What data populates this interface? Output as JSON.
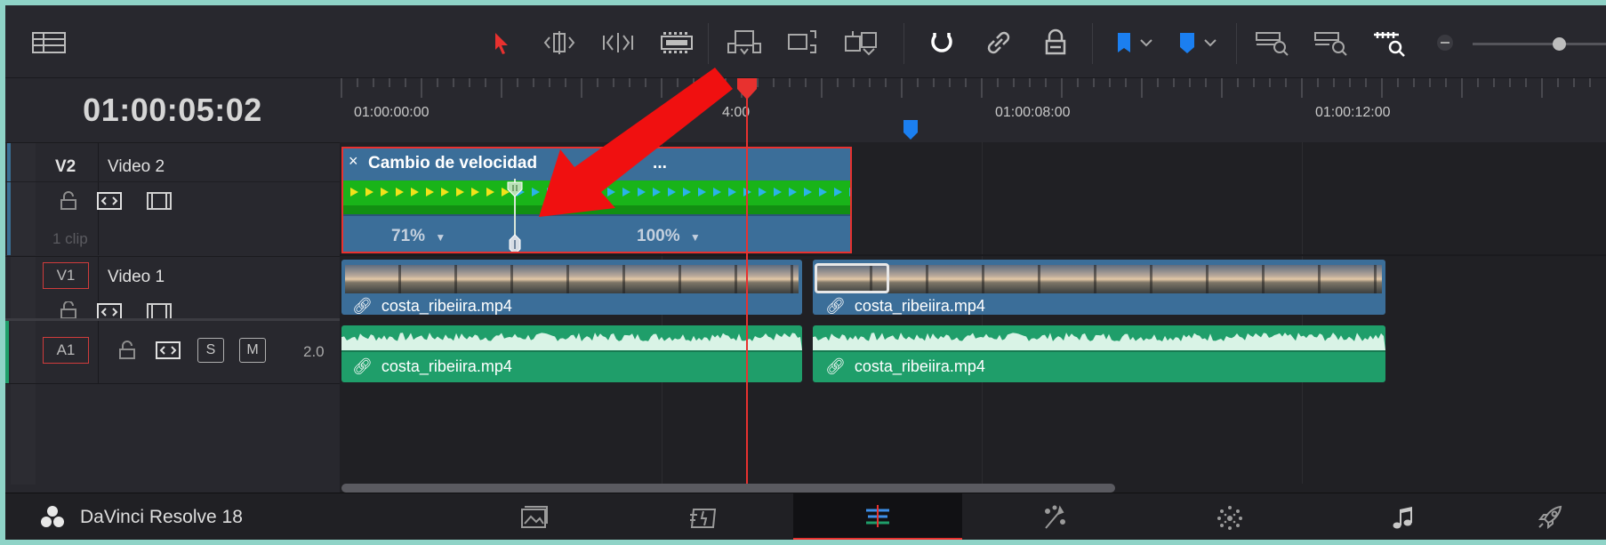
{
  "app": {
    "name": "DaVinci Resolve 18",
    "timecode": "01:00:05:02"
  },
  "ruler": {
    "labels": [
      "01:00:00:00",
      "4:00",
      "01:00:08:00",
      "01:00:12:00"
    ]
  },
  "tracks": {
    "v2": {
      "id": "V2",
      "name": "Video 2",
      "clip_count": "1 clip",
      "clip_title": "Cambio de velocidad",
      "clip_title_suffix": "...",
      "speed_left": "71%",
      "speed_right": "100%"
    },
    "v1": {
      "id": "V1",
      "name": "Video 1",
      "clip_left_label": "costa_ribeiira.mp4",
      "clip_right_label": "costa_ribeiira.mp4"
    },
    "a1": {
      "id": "A1",
      "channels": "2.0",
      "solo_label": "S",
      "mute_label": "M",
      "clip_left_label": "costa_ribeiira.mp4",
      "clip_right_label": "costa_ribeiira.mp4"
    }
  },
  "colors": {
    "accent_red": "#e8312f",
    "video_clip": "#3b6e99",
    "audio_clip": "#1f9e6a",
    "marker_blue": "#1b7ff0",
    "speed_green": "#19b419"
  },
  "pages": [
    "media",
    "cut",
    "edit",
    "fusion",
    "color",
    "fairlight",
    "deliver"
  ],
  "active_page": "edit",
  "icons": {
    "toolbar": [
      "timeline-view-icon",
      "selection-arrow-icon",
      "trim-icon",
      "dynamic-trim-icon",
      "blade-icon",
      "insert-clip-icon",
      "overwrite-clip-icon",
      "replace-clip-icon",
      "snapping-icon",
      "linked-selection-icon",
      "position-lock-icon",
      "flag-icon",
      "marker-icon",
      "zoom-full-icon",
      "zoom-detail-icon",
      "zoom-custom-icon",
      "zoom-out-icon"
    ]
  }
}
